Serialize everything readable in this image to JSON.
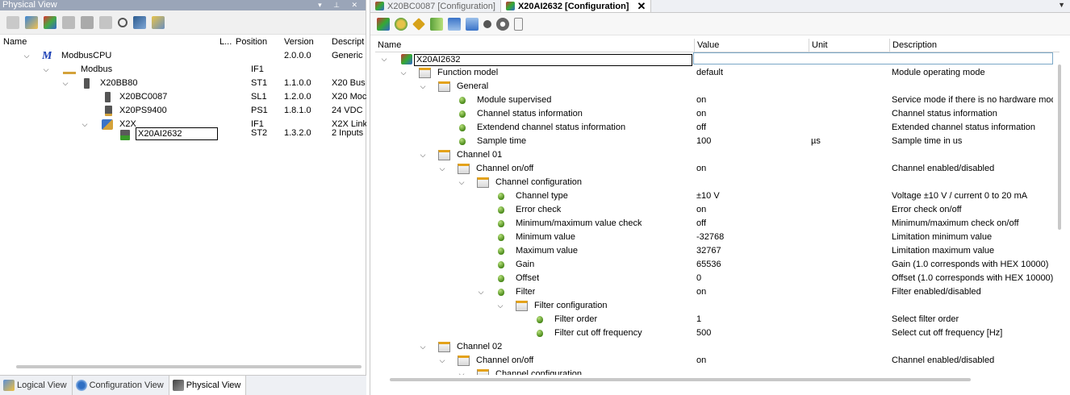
{
  "left": {
    "title": "Physical View",
    "title_controls": "▾ ⊥ ✕",
    "columns": [
      "Name",
      "L...",
      "Position",
      "Version",
      "Descript"
    ],
    "tree": [
      {
        "name": "ModbusCPU",
        "position": "",
        "version": "2.0.0.0",
        "description": "Generic",
        "icon": "modbus-m-icon"
      },
      {
        "name": "Modbus",
        "position": "IF1",
        "version": "",
        "description": "",
        "icon": "bus-icon"
      },
      {
        "name": "X20BB80",
        "position": "ST1",
        "version": "1.1.0.0",
        "description": "X20 Bus",
        "icon": "module-icon"
      },
      {
        "name": "X20BC0087",
        "position": "SL1",
        "version": "1.2.0.0",
        "description": "X20 Moc",
        "icon": "module-icon"
      },
      {
        "name": "X20PS9400",
        "position": "PS1",
        "version": "1.8.1.0",
        "description": "24 VDC",
        "icon": "module-icon"
      },
      {
        "name": "X2X",
        "position": "IF1",
        "version": "",
        "description": "X2X Link",
        "icon": "x2x-icon"
      },
      {
        "name": "X20AI2632",
        "position": "ST2",
        "version": "1.3.2.0",
        "description": "2 Inputs",
        "icon": "analog-module-icon"
      }
    ],
    "bottom_tabs": [
      {
        "label": "Logical View"
      },
      {
        "label": "Configuration View"
      },
      {
        "label": "Physical View"
      }
    ]
  },
  "right": {
    "tabs": [
      {
        "label": "X20BC0087 [Configuration]"
      },
      {
        "label": "X20AI2632 [Configuration]",
        "close": "✕"
      }
    ],
    "columns": [
      "Name",
      "Value",
      "Unit",
      "Description"
    ],
    "root": {
      "name": "X20AI2632"
    },
    "rows": [
      {
        "name": "Function model",
        "value": "default",
        "unit": "",
        "desc": "Module operating mode",
        "kind": "folder"
      },
      {
        "name": "General",
        "value": "",
        "unit": "",
        "desc": "",
        "kind": "folder"
      },
      {
        "name": "Module supervised",
        "value": "on",
        "unit": "",
        "desc": "Service mode if there is no hardware modu",
        "kind": "param"
      },
      {
        "name": "Channel status information",
        "value": "on",
        "unit": "",
        "desc": "Channel status information",
        "kind": "param"
      },
      {
        "name": "Extendend channel status information",
        "value": "off",
        "unit": "",
        "desc": "Extended channel status information",
        "kind": "param"
      },
      {
        "name": "Sample time",
        "value": "100",
        "unit": "µs",
        "desc": "Sample time in us",
        "kind": "param"
      },
      {
        "name": "Channel 01",
        "value": "",
        "unit": "",
        "desc": "",
        "kind": "folder"
      },
      {
        "name": "Channel on/off",
        "value": "on",
        "unit": "",
        "desc": "Channel enabled/disabled",
        "kind": "folder"
      },
      {
        "name": "Channel configuration",
        "value": "",
        "unit": "",
        "desc": "",
        "kind": "folder"
      },
      {
        "name": "Channel type",
        "value": "±10 V",
        "unit": "",
        "desc": "Voltage ±10 V / current 0 to 20 mA",
        "kind": "param"
      },
      {
        "name": "Error check",
        "value": "on",
        "unit": "",
        "desc": "Error check on/off",
        "kind": "param"
      },
      {
        "name": "Minimum/maximum value check",
        "value": "off",
        "unit": "",
        "desc": "Minimum/maximum check on/off",
        "kind": "param"
      },
      {
        "name": "Minimum value",
        "value": "-32768",
        "unit": "",
        "desc": "Limitation minimum value",
        "kind": "param"
      },
      {
        "name": "Maximum value",
        "value": "32767",
        "unit": "",
        "desc": "Limitation maximum value",
        "kind": "param"
      },
      {
        "name": "Gain",
        "value": "65536",
        "unit": "",
        "desc": "Gain (1.0 corresponds with HEX 10000)",
        "kind": "param"
      },
      {
        "name": "Offset",
        "value": "0",
        "unit": "",
        "desc": "Offset (1.0 corresponds with HEX 10000)",
        "kind": "param"
      },
      {
        "name": "Filter",
        "value": "on",
        "unit": "",
        "desc": "Filter enabled/disabled",
        "kind": "param"
      },
      {
        "name": "Filter configuration",
        "value": "",
        "unit": "",
        "desc": "",
        "kind": "folder"
      },
      {
        "name": "Filter order",
        "value": "1",
        "unit": "",
        "desc": "Select filter order",
        "kind": "param"
      },
      {
        "name": "Filter cut off frequency",
        "value": "500",
        "unit": "",
        "desc": "Select cut off frequency [Hz]",
        "kind": "param"
      },
      {
        "name": "Channel 02",
        "value": "",
        "unit": "",
        "desc": "",
        "kind": "folder"
      },
      {
        "name": "Channel on/off",
        "value": "on",
        "unit": "",
        "desc": "Channel enabled/disabled",
        "kind": "folder"
      },
      {
        "name": "Channel configuration",
        "value": "",
        "unit": "",
        "desc": "",
        "kind": "folder"
      }
    ]
  }
}
